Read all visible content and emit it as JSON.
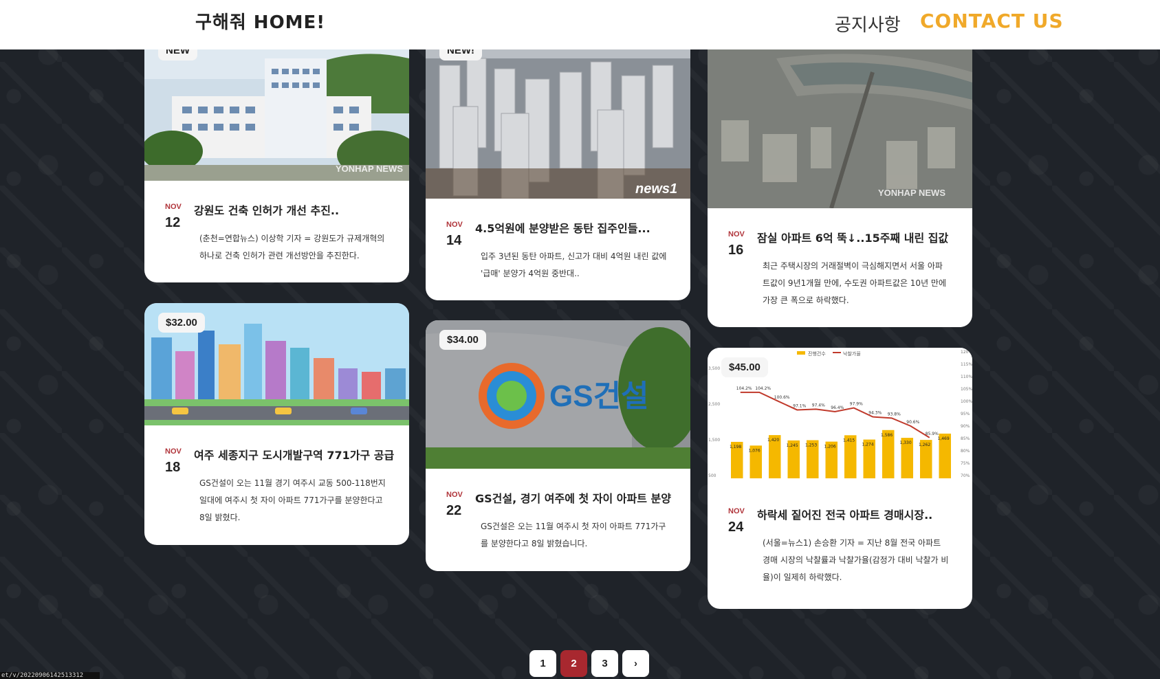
{
  "header": {
    "logo": "구해줘 HOME!",
    "nav_notice": "공지사항",
    "nav_contact": "CONTACT US"
  },
  "colors": {
    "accent": "#f0a92a",
    "date_month": "#b0343a",
    "active_page": "#a8282f",
    "background": "#1f2329"
  },
  "cards": [
    {
      "badge": "NEW",
      "month": "NOV",
      "day": "12",
      "title": "강원도 건축 인허가 개선 추진..",
      "text": "(춘천=연합뉴스) 이상학 기자 = 강원도가 규제개혁의 하나로 건축 인허가 관련 개선방안을 추진한다.",
      "image": "government-building-photo",
      "watermark": "YONHAP NEWS"
    },
    {
      "badge": "NEW!",
      "month": "NOV",
      "day": "14",
      "title": "4.5억원에 분양받은 동탄 집주인들...",
      "text": "입주 3년된 동탄 아파트, 신고가 대비 4억원 내린 값에 '급매' 분양가 4억원 중반대..",
      "image": "apartment-complex-photo",
      "watermark": "news1"
    },
    {
      "badge": "",
      "month": "NOV",
      "day": "16",
      "title": "잠실 아파트 6억 뚝↓..15주째 내린 집값",
      "text": "최근 주택시장의 거래절벽이 극심해지면서 서울 아파트값이 9년1개월 만에, 수도권 아파트값은 10년 만에 가장 큰 폭으로 하락했다.",
      "image": "jamsil-aerial-photo",
      "watermark": "YONHAP NEWS"
    },
    {
      "badge": "$32.00",
      "month": "NOV",
      "day": "18",
      "title": "여주 세종지구 도시개발구역 771가구 공급",
      "text": "GS건설이 오는 11월 경기 여주시 교동 500-118번지 일대에 여주시 첫 자이 아파트 771가구를 분양한다고 8일 밝혔다.",
      "image": "city-illustration"
    },
    {
      "badge": "$34.00",
      "month": "NOV",
      "day": "22",
      "title": "GS건설, 경기 여주에 첫 자이 아파트 분양",
      "text": "GS건설은 오는 11월 여주시 첫 자이 아파트 771가구를 분양한다고 8일 밝혔습니다.",
      "image": "gs-building-photo",
      "logo_text": "GS건설"
    },
    {
      "badge": "$45.00",
      "month": "NOV",
      "day": "24",
      "title": "하락세 짙어진 전국 아파트 경매시장..",
      "text": "(서울=뉴스1) 손승환 기자 = 지난 8월 전국 아파트 경매 시장의 낙찰률과 낙찰가율(감정가 대비 낙찰가 비율)이 일제히 하락했다.",
      "image": "auction-chart",
      "chart_legend": [
        "진행건수",
        "낙찰가율"
      ],
      "chart_bars": [
        "1,198",
        "1,076",
        "1,420",
        "1,245",
        "1,253",
        "1,206",
        "1,415",
        "1,274",
        "1,586",
        "1,330",
        "1,262",
        "1,469"
      ],
      "chart_rates": [
        "104.2%",
        "104.2%",
        "100.6%",
        "97.1%",
        "97.4%",
        "96.4%",
        "97.9%",
        "94.3%",
        "93.8%",
        "90.6%",
        "85.9%"
      ],
      "chart_yaxis": [
        "3,500",
        "2,500",
        "1,500",
        "500"
      ],
      "chart_yaxis_right": [
        "120%",
        "115%",
        "110%",
        "105%",
        "100%",
        "95%",
        "90%",
        "85%",
        "80%",
        "75%",
        "70%"
      ]
    }
  ],
  "pagination": {
    "pages": [
      "1",
      "2",
      "3"
    ],
    "active": "2",
    "next": "›"
  },
  "statusbar": "et/v/20220906142513312"
}
